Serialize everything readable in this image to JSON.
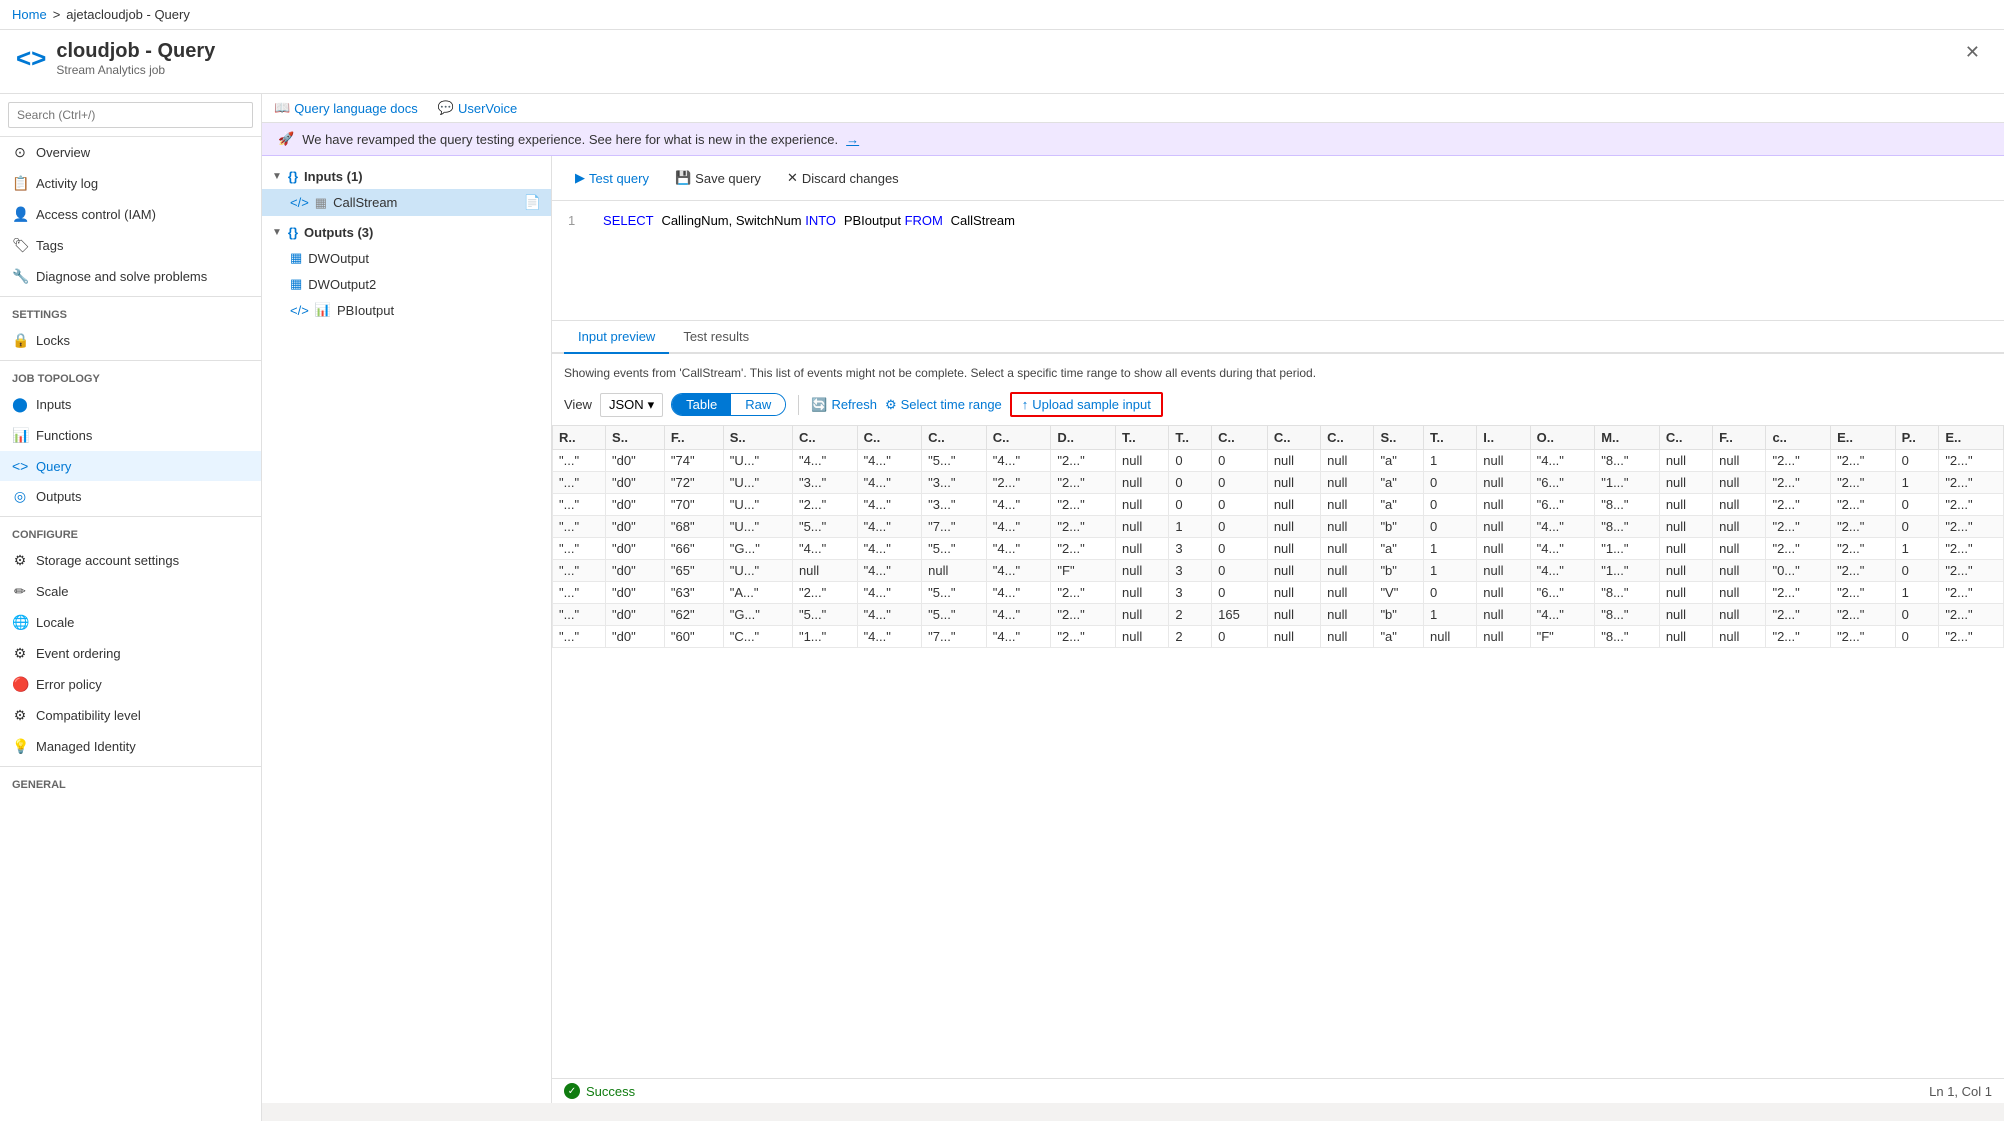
{
  "topbar": {
    "breadcrumb_home": "Home",
    "breadcrumb_sep": ">",
    "breadcrumb_page": "ajetacloudjob - Query"
  },
  "header": {
    "icon": "<>",
    "title": "cloudjob - Query",
    "subtitle": "Stream Analytics job",
    "close_label": "✕"
  },
  "sidebar": {
    "search_placeholder": "Search (Ctrl+/)",
    "items": [
      {
        "id": "overview",
        "label": "Overview",
        "icon": "⊙"
      },
      {
        "id": "activity-log",
        "label": "Activity log",
        "icon": "📋"
      },
      {
        "id": "access-control",
        "label": "Access control (IAM)",
        "icon": "👤"
      },
      {
        "id": "tags",
        "label": "Tags",
        "icon": "🏷"
      },
      {
        "id": "diagnose",
        "label": "Diagnose and solve problems",
        "icon": "🔧"
      }
    ],
    "settings_label": "Settings",
    "settings_items": [
      {
        "id": "locks",
        "label": "Locks",
        "icon": "🔒"
      }
    ],
    "job_topology_label": "Job topology",
    "job_topology_items": [
      {
        "id": "inputs",
        "label": "Inputs",
        "icon": "⬤"
      },
      {
        "id": "functions",
        "label": "Functions",
        "icon": "📊"
      },
      {
        "id": "query",
        "label": "Query",
        "icon": "<>"
      },
      {
        "id": "outputs",
        "label": "Outputs",
        "icon": "◎"
      }
    ],
    "configure_label": "Configure",
    "configure_items": [
      {
        "id": "storage-account",
        "label": "Storage account settings",
        "icon": "⚙"
      },
      {
        "id": "scale",
        "label": "Scale",
        "icon": "✏"
      },
      {
        "id": "locale",
        "label": "Locale",
        "icon": "🌐"
      },
      {
        "id": "event-ordering",
        "label": "Event ordering",
        "icon": "⚙"
      },
      {
        "id": "error-policy",
        "label": "Error policy",
        "icon": "🔴"
      },
      {
        "id": "compatibility",
        "label": "Compatibility level",
        "icon": "⚙"
      },
      {
        "id": "managed-identity",
        "label": "Managed Identity",
        "icon": "💡"
      }
    ],
    "general_label": "General"
  },
  "query_topbar": {
    "docs_label": "Query language docs",
    "uservoice_label": "UserVoice"
  },
  "banner": {
    "icon": "🚀",
    "text": "We have revamped the query testing experience. See here for what is new in the experience.",
    "arrow": "→"
  },
  "tree": {
    "inputs_label": "Inputs (1)",
    "inputs": [
      {
        "label": "CallStream",
        "selected": true
      }
    ],
    "outputs_label": "Outputs (3)",
    "outputs": [
      {
        "label": "DWOutput"
      },
      {
        "label": "DWOutput2"
      },
      {
        "label": "PBIoutput"
      }
    ]
  },
  "query_toolbar": {
    "test_query": "Test query",
    "save_query": "Save query",
    "discard_changes": "Discard changes"
  },
  "editor": {
    "line1_num": "1",
    "line1_code": "SELECT CallingNum, SwitchNum INTO PBIoutput FROM CallStream"
  },
  "results": {
    "tab_input": "Input preview",
    "tab_test": "Test results",
    "info_text": "Showing events from 'CallStream'. This list of events might not be complete. Select a specific time range to show all events during that period.",
    "view_label": "View",
    "view_option": "JSON",
    "toggle_table": "Table",
    "toggle_raw": "Raw",
    "refresh_label": "Refresh",
    "time_range_label": "Select time range",
    "upload_label": "Upload sample input",
    "columns": [
      "R..",
      "S..",
      "F..",
      "S..",
      "C..",
      "C..",
      "C..",
      "C..",
      "D..",
      "T..",
      "T..",
      "C..",
      "C..",
      "C..",
      "S..",
      "T..",
      "I..",
      "O..",
      "M..",
      "C..",
      "F..",
      "c..",
      "E..",
      "P..",
      "E.."
    ],
    "rows": [
      [
        "\"...\"",
        "\"d0\"",
        "\"74\"",
        "\"U...\"",
        "\"4...\"",
        "\"4...\"",
        "\"5...\"",
        "\"4...\"",
        "\"2...\"",
        "null",
        "0",
        "0",
        "null",
        "null",
        "\"a\"",
        "1",
        "null",
        "\"4...\"",
        "\"8...\"",
        "null",
        "null",
        "\"2...\"",
        "\"2...\"",
        "0",
        "\"2...\""
      ],
      [
        "\"...\"",
        "\"d0\"",
        "\"72\"",
        "\"U...\"",
        "\"3...\"",
        "\"4...\"",
        "\"3...\"",
        "\"2...\"",
        "\"2...\"",
        "null",
        "0",
        "0",
        "null",
        "null",
        "\"a\"",
        "0",
        "null",
        "\"6...\"",
        "\"1...\"",
        "null",
        "null",
        "\"2...\"",
        "\"2...\"",
        "1",
        "\"2...\""
      ],
      [
        "\"...\"",
        "\"d0\"",
        "\"70\"",
        "\"U...\"",
        "\"2...\"",
        "\"4...\"",
        "\"3...\"",
        "\"4...\"",
        "\"2...\"",
        "null",
        "0",
        "0",
        "null",
        "null",
        "\"a\"",
        "0",
        "null",
        "\"6...\"",
        "\"8...\"",
        "null",
        "null",
        "\"2...\"",
        "\"2...\"",
        "0",
        "\"2...\""
      ],
      [
        "\"...\"",
        "\"d0\"",
        "\"68\"",
        "\"U...\"",
        "\"5...\"",
        "\"4...\"",
        "\"7...\"",
        "\"4...\"",
        "\"2...\"",
        "null",
        "1",
        "0",
        "null",
        "null",
        "\"b\"",
        "0",
        "null",
        "\"4...\"",
        "\"8...\"",
        "null",
        "null",
        "\"2...\"",
        "\"2...\"",
        "0",
        "\"2...\""
      ],
      [
        "\"...\"",
        "\"d0\"",
        "\"66\"",
        "\"G...\"",
        "\"4...\"",
        "\"4...\"",
        "\"5...\"",
        "\"4...\"",
        "\"2...\"",
        "null",
        "3",
        "0",
        "null",
        "null",
        "\"a\"",
        "1",
        "null",
        "\"4...\"",
        "\"1...\"",
        "null",
        "null",
        "\"2...\"",
        "\"2...\"",
        "1",
        "\"2...\""
      ],
      [
        "\"...\"",
        "\"d0\"",
        "\"65\"",
        "\"U...\"",
        "null",
        "\"4...\"",
        "null",
        "\"4...\"",
        "\"F\"",
        "null",
        "3",
        "0",
        "null",
        "null",
        "\"b\"",
        "1",
        "null",
        "\"4...\"",
        "\"1...\"",
        "null",
        "null",
        "\"0...\"",
        "\"2...\"",
        "0",
        "\"2...\""
      ],
      [
        "\"...\"",
        "\"d0\"",
        "\"63\"",
        "\"A...\"",
        "\"2...\"",
        "\"4...\"",
        "\"5...\"",
        "\"4...\"",
        "\"2...\"",
        "null",
        "3",
        "0",
        "null",
        "null",
        "\"V\"",
        "0",
        "null",
        "\"6...\"",
        "\"8...\"",
        "null",
        "null",
        "\"2...\"",
        "\"2...\"",
        "1",
        "\"2...\""
      ],
      [
        "\"...\"",
        "\"d0\"",
        "\"62\"",
        "\"G...\"",
        "\"5...\"",
        "\"4...\"",
        "\"5...\"",
        "\"4...\"",
        "\"2...\"",
        "null",
        "2",
        "165",
        "null",
        "null",
        "\"b\"",
        "1",
        "null",
        "\"4...\"",
        "\"8...\"",
        "null",
        "null",
        "\"2...\"",
        "\"2...\"",
        "0",
        "\"2...\""
      ],
      [
        "\"...\"",
        "\"d0\"",
        "\"60\"",
        "\"C...\"",
        "\"1...\"",
        "\"4...\"",
        "\"7...\"",
        "\"4...\"",
        "\"2...\"",
        "null",
        "2",
        "0",
        "null",
        "null",
        "\"a\"",
        "null",
        "null",
        "\"F\"",
        "\"8...\"",
        "null",
        "null",
        "\"2...\"",
        "\"2...\"",
        "0",
        "\"2...\""
      ]
    ]
  },
  "status": {
    "success_icon": "✓",
    "success_text": "Success",
    "position": "Ln 1, Col 1"
  }
}
